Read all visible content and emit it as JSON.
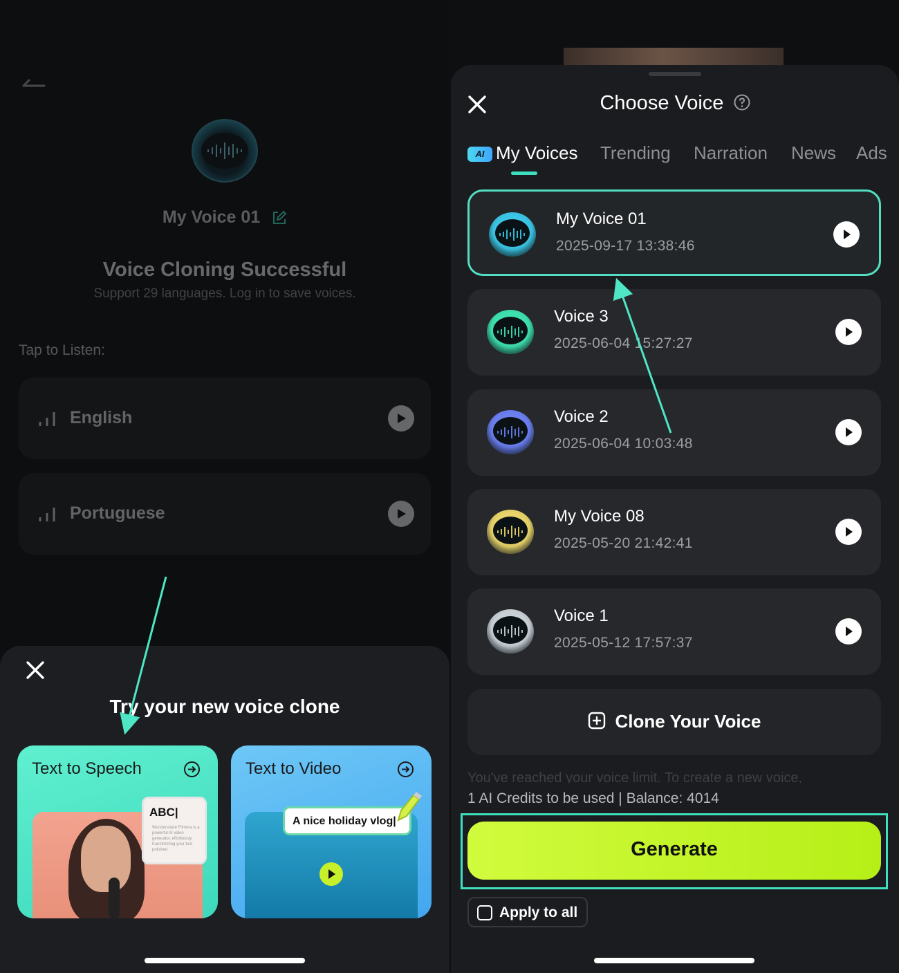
{
  "left": {
    "voice_name": "My Voice 01",
    "success_title": "Voice Cloning Successful",
    "success_subtitle": "Support 29 languages. Log in to save voices.",
    "tap_to_listen": "Tap to Listen:",
    "languages": [
      {
        "label": "English"
      },
      {
        "label": "Portuguese"
      }
    ],
    "sheet": {
      "title": "Try your new voice clone",
      "cards": [
        {
          "label": "Text to Speech",
          "bubble_text": "ABC|",
          "bubble_fine": "Wondershare Filmora is a powerful AI video generator, effortlessly transforming your text polished"
        },
        {
          "label": "Text to Video",
          "bubble_text": "A nice holiday vlog|"
        }
      ]
    }
  },
  "right": {
    "title": "Choose Voice",
    "tabs": [
      {
        "label": "My Voices",
        "badge": "AI",
        "active": true
      },
      {
        "label": "Trending"
      },
      {
        "label": "Narration"
      },
      {
        "label": "News"
      },
      {
        "label": "Ads"
      }
    ],
    "voices": [
      {
        "name": "My Voice 01",
        "date": "2025-09-17 13:38:46",
        "selected": true,
        "color": "#3cc6e6"
      },
      {
        "name": "Voice 3",
        "date": "2025-06-04 15:27:27",
        "color": "#3fe0b0"
      },
      {
        "name": "Voice 2",
        "date": "2025-06-04 10:03:48",
        "color": "#6b7ff0"
      },
      {
        "name": "My Voice 08",
        "date": "2025-05-20 21:42:41",
        "color": "#e8d46a"
      },
      {
        "name": "Voice 1",
        "date": "2025-05-12 17:57:37",
        "color": "#c9d0d6"
      }
    ],
    "clone_button": "Clone Your Voice",
    "limit_text": "You've reached your voice limit. To create a new voice,",
    "credits": "1 AI Credits to be used |  Balance: 4014",
    "generate": "Generate",
    "apply_to_all": "Apply to all"
  },
  "colors": {
    "accent": "#3fe0c0",
    "generate": "#c6f52a",
    "card_bg": "#26282c"
  }
}
